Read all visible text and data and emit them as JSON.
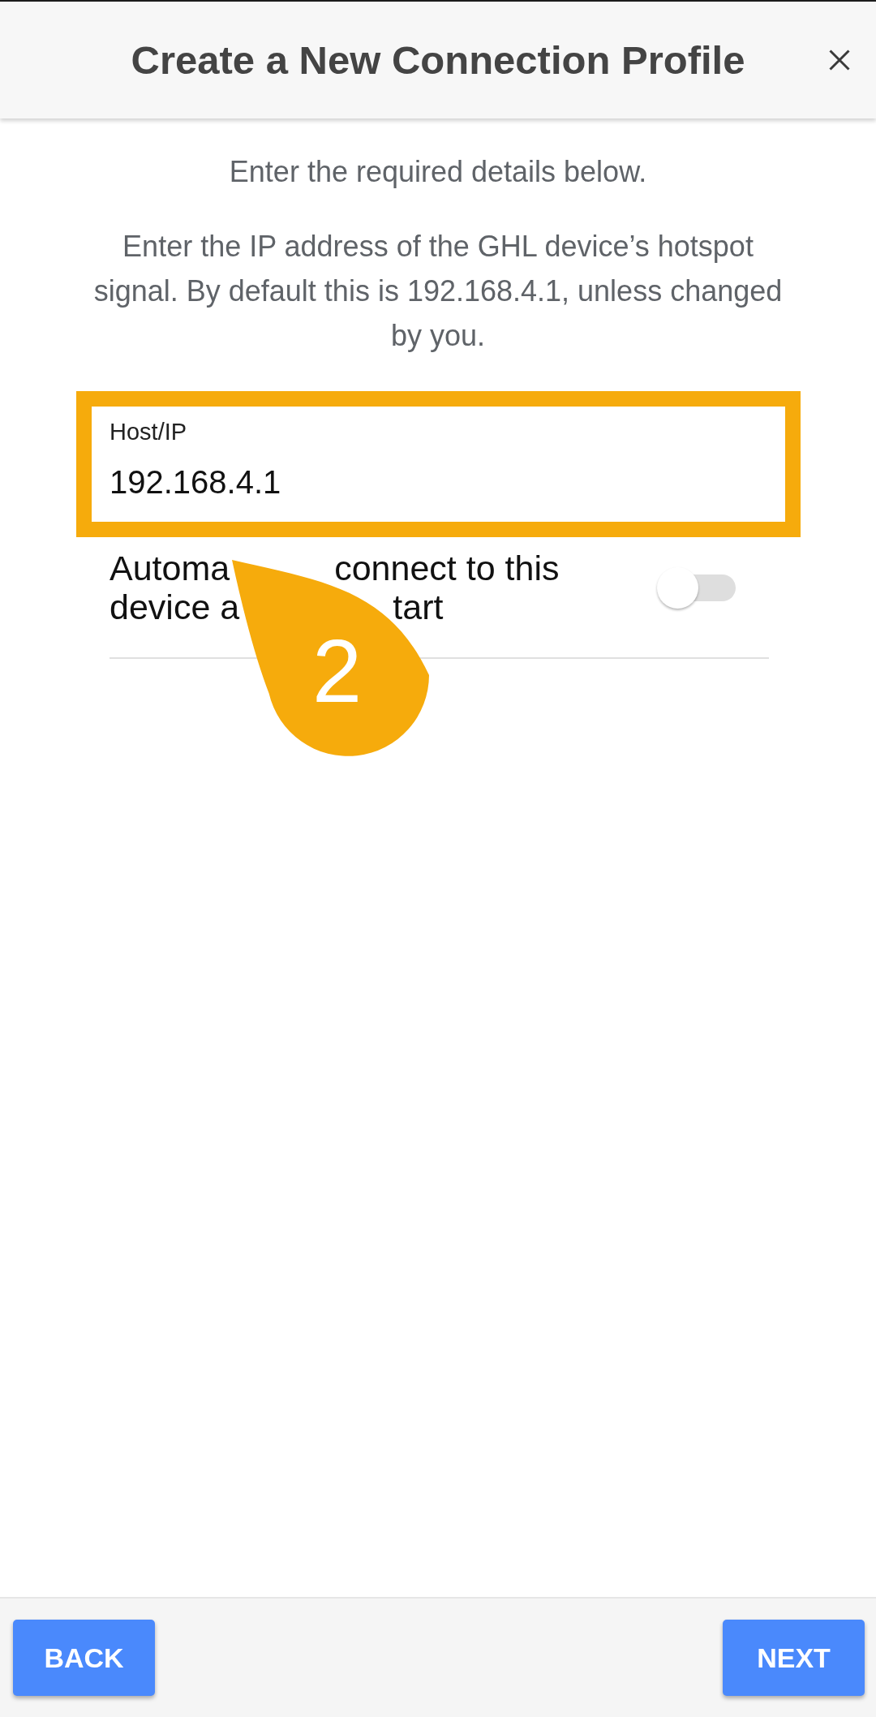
{
  "header": {
    "title": "Create a New Connection Profile"
  },
  "intro": "Enter the required details below.",
  "description": "Enter the IP address of the GHL device’s hotspot signal. By default this is 192.168.4.1, unless changed by you.",
  "host_field": {
    "label": "Host/IP",
    "value": "192.168.4.1",
    "highlighted": true
  },
  "auto_connect": {
    "label_lines": [
      [
        "Automa",
        "connect to this"
      ],
      [
        "device a",
        "tart"
      ]
    ],
    "on": false
  },
  "callout": {
    "number": "2"
  },
  "footer": {
    "buttons": [
      {
        "label": "BACK"
      },
      {
        "label": "NEXT"
      }
    ]
  }
}
